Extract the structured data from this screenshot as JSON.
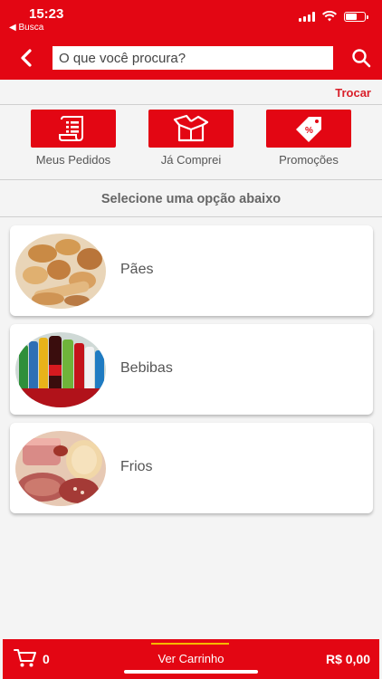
{
  "status_bar": {
    "time": "15:23",
    "back_app": "◀ Busca"
  },
  "search": {
    "placeholder": "O que você procura?"
  },
  "store": {
    "switch_label": "Trocar"
  },
  "shortcuts": [
    {
      "label": "Meus Pedidos",
      "icon": "orders-list-icon"
    },
    {
      "label": "Já Comprei",
      "icon": "open-box-icon"
    },
    {
      "label": "Promoções",
      "icon": "discount-tag-icon"
    }
  ],
  "section_title": "Selecione uma opção abaixo",
  "categories": [
    {
      "name": "Pães"
    },
    {
      "name": "Bebibas"
    },
    {
      "name": "Frios"
    }
  ],
  "cart": {
    "count": "0",
    "view_label": "Ver Carrinho",
    "total": "R$ 0,00"
  },
  "colors": {
    "brand_red": "#e30613",
    "accent_yellow": "#f6b800",
    "link_red": "#d9202a"
  }
}
